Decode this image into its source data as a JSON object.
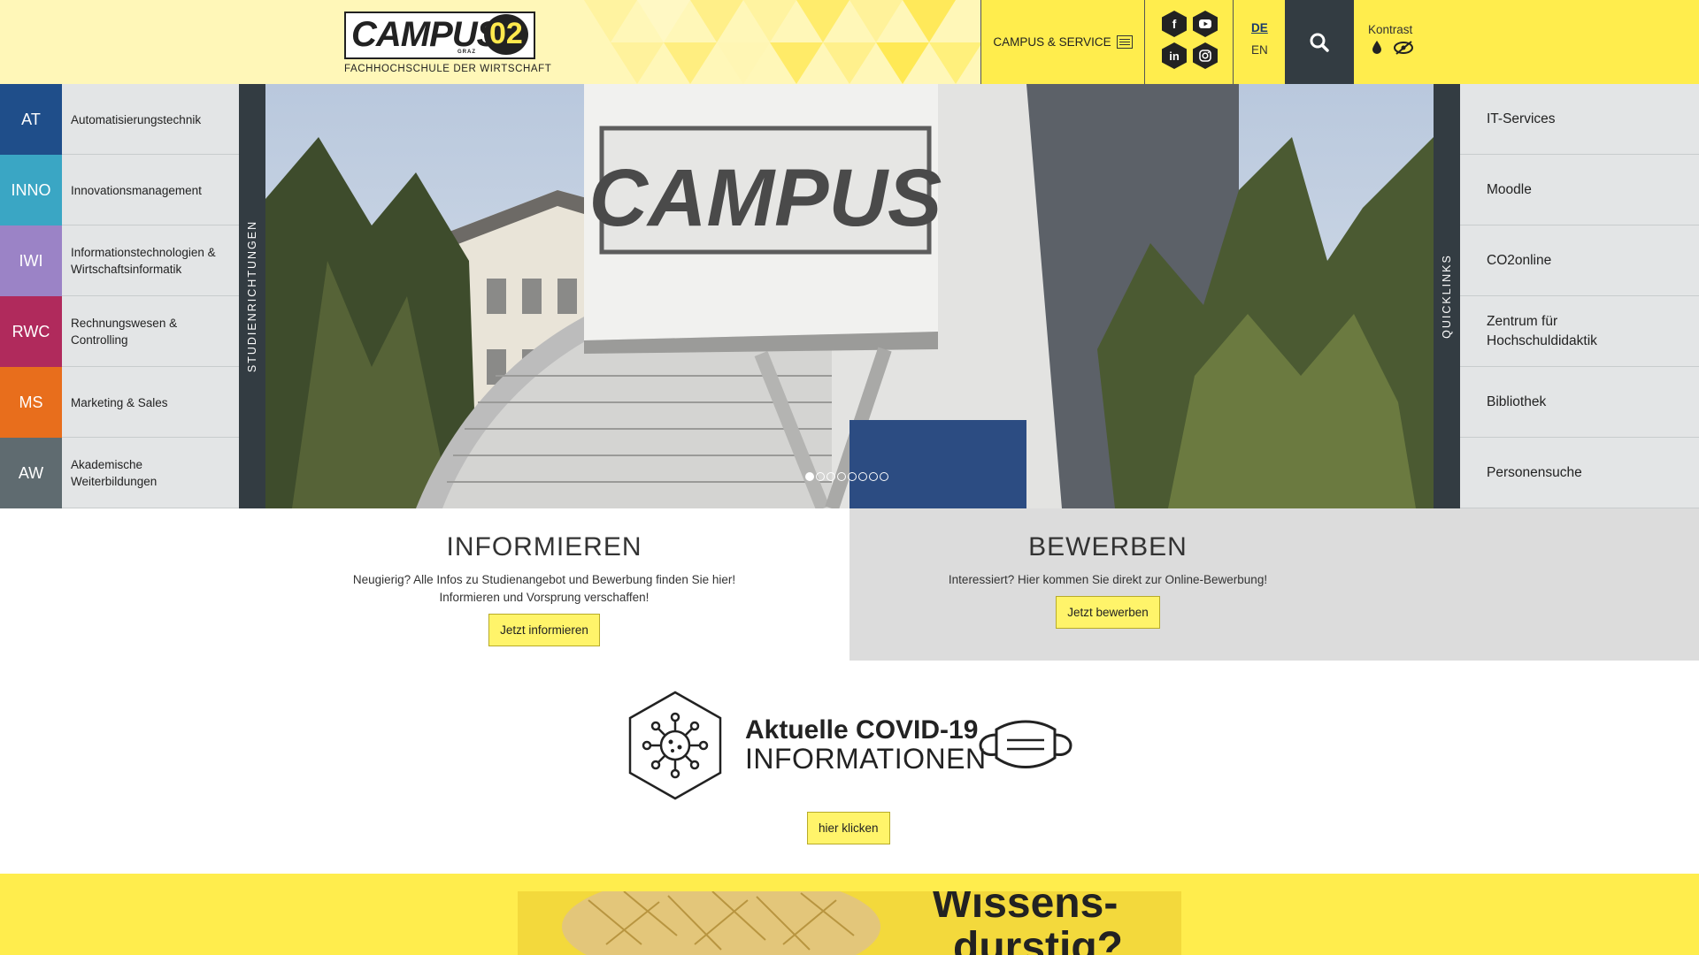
{
  "header": {
    "logo_word": "CAMPUS",
    "logo_graz": "GRAZ",
    "logo_number": "02",
    "logo_tagline": "FACHHOCHSCHULE DER WIRTSCHAFT",
    "campus_service": "CAMPUS & SERVICE",
    "social_icons": [
      "facebook-icon",
      "youtube-icon",
      "linkedin-icon",
      "instagram-icon"
    ],
    "lang_de": "DE",
    "lang_en": "EN",
    "contrast_label": "Kontrast"
  },
  "colors": {
    "header_bg": "#fff7b8",
    "brand_yellow": "#ffed4d",
    "dark": "#333c42"
  },
  "programs_label": "STUDIENRICHTUNGEN",
  "programs": [
    {
      "code": "AT",
      "name": "Automatisierungstechnik",
      "color": "#1f4e8a"
    },
    {
      "code": "INNO",
      "name": "Innovationsmanagement",
      "color": "#3aa6c4"
    },
    {
      "code": "IWI",
      "name": "Informationstechnologien & Wirtschaftsinformatik",
      "color": "#9b83c6"
    },
    {
      "code": "RWC",
      "name": "Rechnungswesen & Controlling",
      "color": "#b02a5c"
    },
    {
      "code": "MS",
      "name": "Marketing & Sales",
      "color": "#e86e1c"
    },
    {
      "code": "AW",
      "name": "Akademische Weiterbildungen",
      "color": "#5f6b70"
    }
  ],
  "hero": {
    "sign_text": "CAMPUS",
    "slide_count": 8,
    "active_slide": 1
  },
  "quicklinks_label": "QUICKLINKS",
  "quicklinks": [
    "IT-Services",
    "Moodle",
    "CO2online",
    "Zentrum für Hochschuldidaktik",
    "Bibliothek",
    "Personensuche"
  ],
  "inform": {
    "heading": "INFORMIEREN",
    "text1": "Neugierig? Alle Infos zu Studienangebot und Bewerbung finden Sie hier!",
    "text2": "Informieren und Vorsprung verschaffen!",
    "button": "Jetzt informieren"
  },
  "apply": {
    "heading": "BEWERBEN",
    "text": "Interessiert? Hier kommen Sie direkt zur Online-Bewerbung!",
    "button": "Jetzt bewerben"
  },
  "covid": {
    "title_line1": "Aktuelle COVID-19",
    "title_line2": "INFORMATIONEN",
    "button": "hier klicken"
  },
  "banner": {
    "line1": "Wissens-",
    "line2": "durstig?"
  }
}
